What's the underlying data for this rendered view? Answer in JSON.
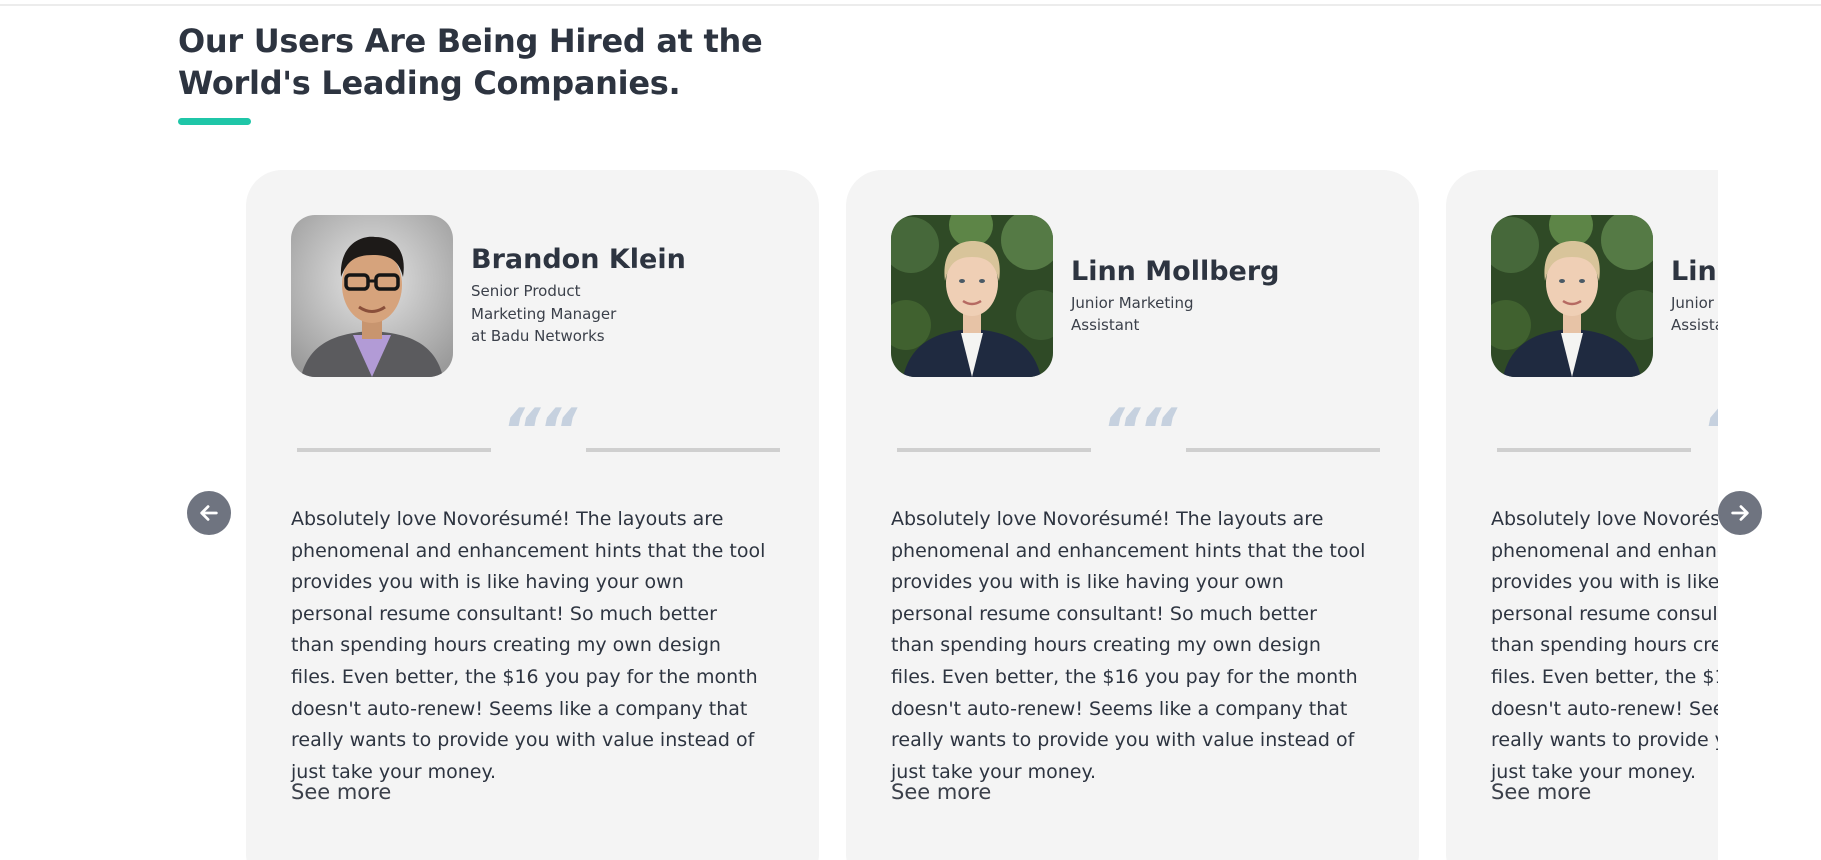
{
  "section": {
    "title": "Our Users Are Being Hired at the World's Leading Companies."
  },
  "testimonials": [
    {
      "name": "Brandon Klein",
      "role": "Senior Product\nMarketing Manager\nat Badu Networks",
      "avatar_icon": "man-portrait-photo",
      "quote_mark": "““",
      "text": "Absolutely love Novorésumé! The layouts are phenomenal and enhancement hints that the tool provides you with is like having your own personal resume consultant! So much better than spending hours creating my own design files. Even better, the $16 you pay for the month doesn't auto-renew! Seems like a company that really wants to provide you with value instead of just take your money.",
      "see_more": "See more"
    },
    {
      "name": "Linn Mollberg",
      "role": "Junior Marketing\nAssistant",
      "avatar_icon": "woman-portrait-photo",
      "quote_mark": "““",
      "text": "Absolutely love Novorésumé! The layouts are phenomenal and enhancement hints that the tool provides you with is like having your own personal resume consultant! So much better than spending hours creating my own design files. Even better, the $16 you pay for the month doesn't auto-renew! Seems like a company that really wants to provide you with value instead of just take your money.",
      "see_more": "See more"
    },
    {
      "name": "Linn Mollberg",
      "role": "Junior Marketing\nAssistant",
      "avatar_icon": "woman-portrait-photo",
      "quote_mark": "““",
      "text": "Absolutely love Novorésumé! The layouts are phenomenal and enhancement hints that the tool provides you with is like having your own personal resume consultant! So much better than spending hours creating my own design files. Even better, the $16 you pay for the month doesn't auto-renew! Seems like a company that really wants to provide you with value instead of just take your money.",
      "see_more": "See more"
    }
  ],
  "controls": {
    "prev_icon": "arrow-left-icon",
    "next_icon": "arrow-right-icon"
  },
  "colors": {
    "accent": "#1fc6a8",
    "heading": "#2d3440",
    "card_bg": "#f4f4f4",
    "arrow_bg": "#6f7480",
    "quote_mark": "#c6d1df"
  }
}
